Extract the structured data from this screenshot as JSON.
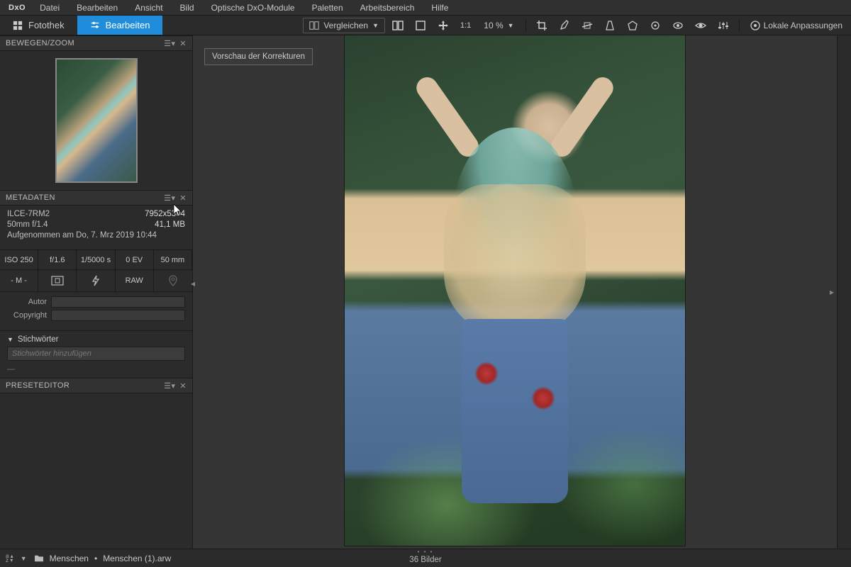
{
  "app": {
    "logo": "DxO"
  },
  "menu": {
    "items": [
      "Datei",
      "Bearbeiten",
      "Ansicht",
      "Bild",
      "Optische DxO-Module",
      "Paletten",
      "Arbeitsbereich",
      "Hilfe"
    ]
  },
  "tabs": {
    "fotothek": "Fotothek",
    "bearbeiten": "Bearbeiten"
  },
  "toolbar": {
    "compare": "Vergleichen",
    "ratio": "1:1",
    "zoom": "10 %",
    "local_adjust": "Lokale Anpassungen"
  },
  "panels": {
    "navigator": {
      "title": "BEWEGEN/ZOOM"
    },
    "metadata": {
      "title": "METADATEN",
      "camera": "ILCE-7RM2",
      "dimensions": "7952x5304",
      "lens": "50mm f/1.4",
      "filesize": "41,1 MB",
      "captured": "Aufgenommen am Do, 7. Mrz 2019 10:44",
      "iso": "ISO 250",
      "aperture": "f/1.6",
      "shutter": "1/5000 s",
      "ev": "0 EV",
      "focal": "50 mm",
      "mode": "- M -",
      "raw": "RAW",
      "author_label": "Autor",
      "copyright_label": "Copyright",
      "keywords_title": "Stichwörter",
      "keywords_placeholder": "Stichwörter hinzufügen"
    },
    "preset": {
      "title": "PRESETEDITOR"
    }
  },
  "canvas": {
    "preview_label": "Vorschau der Korrekturen"
  },
  "status": {
    "folder": "Menschen",
    "file": "Menschen (1).arw",
    "count": "36 Bilder"
  }
}
